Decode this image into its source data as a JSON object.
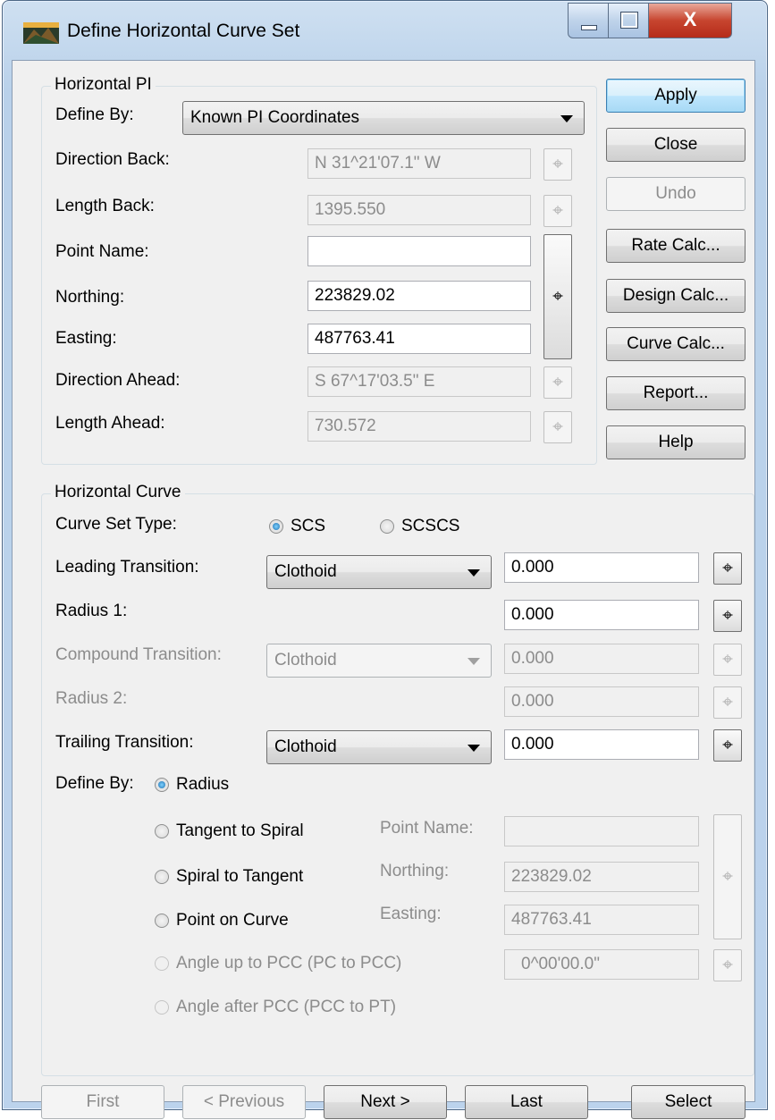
{
  "window": {
    "title": "Define Horizontal Curve Set",
    "close_glyph": "X"
  },
  "pi_group": {
    "title": "Horizontal PI",
    "define_by_label": "Define By:",
    "define_by_value": "Known PI Coordinates",
    "direction_back_label": "Direction Back:",
    "direction_back_value": "N 31^21'07.1\" W",
    "length_back_label": "Length Back:",
    "length_back_value": "1395.550",
    "point_name_label": "Point Name:",
    "point_name_value": "",
    "northing_label": "Northing:",
    "northing_value": "223829.02",
    "easting_label": "Easting:",
    "easting_value": "487763.41",
    "direction_ahead_label": "Direction Ahead:",
    "direction_ahead_value": "S 67^17'03.5\" E",
    "length_ahead_label": "Length Ahead:",
    "length_ahead_value": "730.572"
  },
  "side_buttons": {
    "apply": "Apply",
    "close": "Close",
    "undo": "Undo",
    "rate_calc": "Rate Calc...",
    "design_calc": "Design Calc...",
    "curve_calc": "Curve Calc...",
    "report": "Report...",
    "help": "Help"
  },
  "curve_group": {
    "title": "Horizontal Curve",
    "curve_set_type_label": "Curve Set Type:",
    "curve_set_type_options": [
      "SCS",
      "SCSCS"
    ],
    "curve_set_type_selected": "SCS",
    "leading_transition_label": "Leading Transition:",
    "leading_transition_value": "Clothoid",
    "leading_transition_length": "0.000",
    "radius1_label": "Radius 1:",
    "radius1_value": "0.000",
    "compound_transition_label": "Compound Transition:",
    "compound_transition_value": "Clothoid",
    "compound_transition_length": "0.000",
    "radius2_label": "Radius 2:",
    "radius2_value": "0.000",
    "trailing_transition_label": "Trailing Transition:",
    "trailing_transition_value": "Clothoid",
    "trailing_transition_length": "0.000",
    "define_by_label": "Define By:",
    "define_by_options": {
      "radius": "Radius",
      "tangent_to_spiral": "Tangent to Spiral",
      "spiral_to_tangent": "Spiral to Tangent",
      "point_on_curve": "Point on Curve",
      "angle_up_to_pcc": "Angle up to PCC (PC to PCC)",
      "angle_after_pcc": "Angle after PCC (PCC to PT)"
    },
    "define_by_selected": "Radius",
    "point_name_label": "Point Name:",
    "point_name_value": "",
    "northing_label": "Northing:",
    "northing_value": "223829.02",
    "easting_label": "Easting:",
    "easting_value": "487763.41",
    "angle_value": "0^00'00.0\""
  },
  "nav_buttons": {
    "first": "First",
    "previous": "< Previous",
    "next": "Next >",
    "last": "Last",
    "select": "Select"
  },
  "icons": {
    "pick_glyph": "⌖",
    "data_point_glyph": "⌖"
  }
}
